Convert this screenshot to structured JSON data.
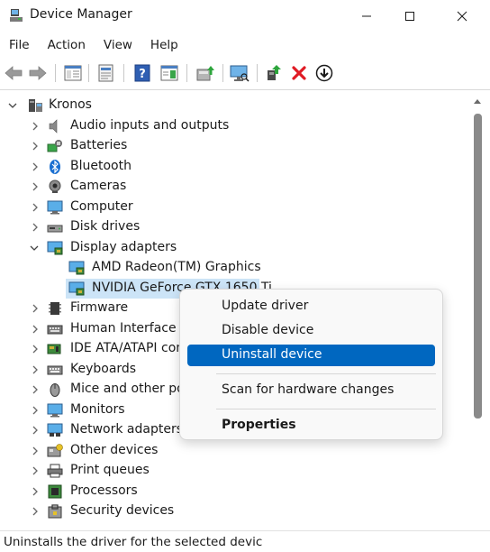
{
  "window": {
    "title": "Device Manager"
  },
  "menu": [
    "File",
    "Action",
    "View",
    "Help"
  ],
  "tree": {
    "root": "Kronos",
    "categories": [
      "Audio inputs and outputs",
      "Batteries",
      "Bluetooth",
      "Cameras",
      "Computer",
      "Disk drives",
      "Display adapters",
      "Firmware",
      "Human Interface D",
      "IDE ATA/ATAPI cont",
      "Keyboards",
      "Mice and other po",
      "Monitors",
      "Network adapters",
      "Other devices",
      "Print queues",
      "Processors",
      "Security devices"
    ],
    "display_children": [
      "AMD Radeon(TM) Graphics",
      "NVIDIA GeForce GTX 1650 Ti"
    ]
  },
  "context_menu": {
    "items": [
      "Update driver",
      "Disable device",
      "Uninstall device",
      "Scan for hardware changes",
      "Properties"
    ],
    "highlighted": "Uninstall device"
  },
  "status": "Uninstalls the driver for the selected devic",
  "colors": {
    "accent": "#0067c0",
    "selection": "#cce4f7",
    "uninstall_red": "#e01b24"
  }
}
